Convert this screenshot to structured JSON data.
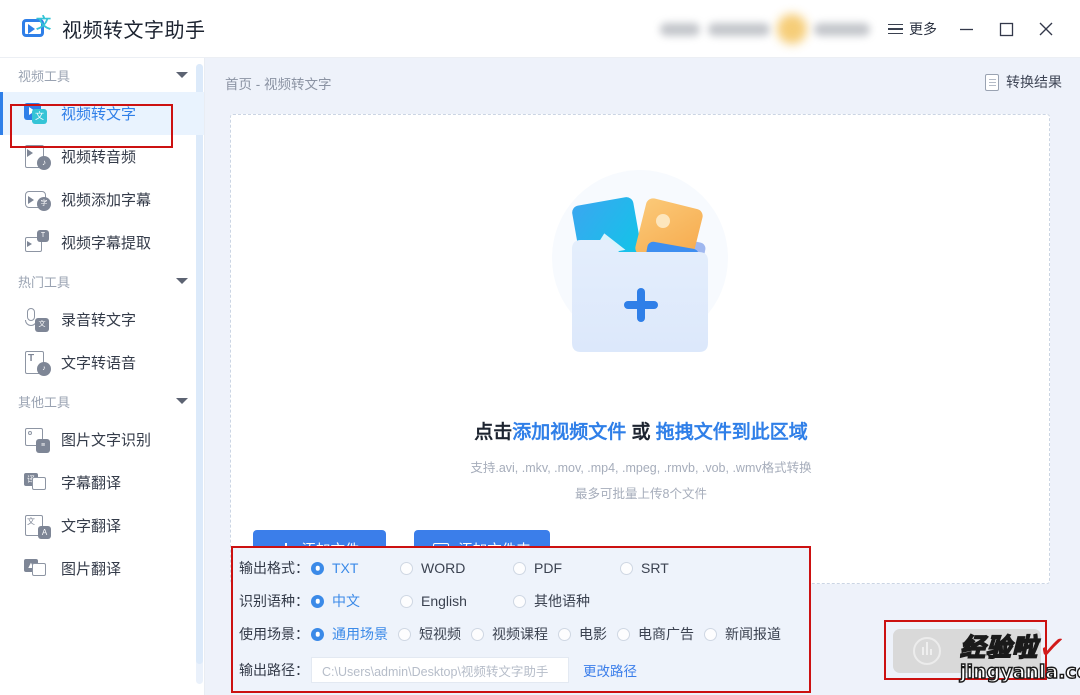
{
  "titlebar": {
    "app_name": "视频转文字助手",
    "logo_icon": "video-to-text-logo-icon",
    "more_label": "更多",
    "more_icon": "hamburger-icon",
    "minimize_icon": "minimize-icon",
    "maximize_icon": "maximize-icon",
    "close_icon": "close-icon",
    "account_blurred": true
  },
  "sidebar": {
    "groups": [
      {
        "label": "视频工具",
        "caret_icon": "chevron-down-icon",
        "items": [
          {
            "label": "视频转文字",
            "icon": "video-to-text-icon",
            "active": true
          },
          {
            "label": "视频转音频",
            "icon": "video-to-audio-icon",
            "active": false
          },
          {
            "label": "视频添加字幕",
            "icon": "video-add-subtitle-icon",
            "active": false
          },
          {
            "label": "视频字幕提取",
            "icon": "video-extract-subtitle-icon",
            "active": false
          }
        ]
      },
      {
        "label": "热门工具",
        "caret_icon": "chevron-down-icon",
        "items": [
          {
            "label": "录音转文字",
            "icon": "audio-to-text-icon",
            "active": false
          },
          {
            "label": "文字转语音",
            "icon": "text-to-speech-icon",
            "active": false
          }
        ]
      },
      {
        "label": "其他工具",
        "caret_icon": "chevron-down-icon",
        "items": [
          {
            "label": "图片文字识别",
            "icon": "image-ocr-icon",
            "active": false
          },
          {
            "label": "字幕翻译",
            "icon": "subtitle-translate-icon",
            "active": false
          },
          {
            "label": "文字翻译",
            "icon": "text-translate-icon",
            "active": false
          },
          {
            "label": "图片翻译",
            "icon": "image-translate-icon",
            "active": false
          }
        ]
      }
    ]
  },
  "content": {
    "breadcrumb": "首页 - 视频转文字",
    "result_link": "转换结果",
    "result_icon": "document-icon",
    "dropzone": {
      "illustration_icon": "folder-with-media-plus-icon",
      "headline_prefix": "点击",
      "headline_link1": "添加视频文件",
      "headline_middle": " 或 ",
      "headline_link2": "拖拽文件到此区域",
      "formats": "支持.avi, .mkv, .mov, .mp4, .mpeg, .rmvb, .vob, .wmv格式转换",
      "limit": "最多可批量上传8个文件",
      "add_file_button": "添加文件",
      "add_file_icon": "plus-icon",
      "add_folder_button": "添加文件夹",
      "add_folder_icon": "folder-icon"
    }
  },
  "options": {
    "rows": [
      {
        "label": "输出格式：",
        "choices": [
          {
            "text": "TXT",
            "selected": true
          },
          {
            "text": "WORD",
            "selected": false
          },
          {
            "text": "PDF",
            "selected": false
          },
          {
            "text": "SRT",
            "selected": false
          }
        ]
      },
      {
        "label": "识别语种：",
        "choices": [
          {
            "text": "中文",
            "selected": true
          },
          {
            "text": "English",
            "selected": false
          },
          {
            "text": "其他语种",
            "selected": false
          }
        ]
      },
      {
        "label": "使用场景：",
        "choices": [
          {
            "text": "通用场景",
            "selected": true
          },
          {
            "text": "短视频",
            "selected": false
          },
          {
            "text": "视频课程",
            "selected": false
          },
          {
            "text": "电影",
            "selected": false
          },
          {
            "text": "电商广告",
            "selected": false
          },
          {
            "text": "新闻报道",
            "selected": false
          }
        ]
      }
    ],
    "path_label": "输出路径：",
    "path_value": "C:\\Users\\admin\\Desktop\\视频转文字助手",
    "path_change_label": "更改路径"
  },
  "convert": {
    "icon": "audio-wave-circle-icon"
  },
  "watermark": {
    "cn": "经验啦",
    "en": "jingyanla.com",
    "check_icon": "red-check-icon"
  },
  "colors": {
    "accent": "#2f7fe8",
    "button_blue": "#3b7eea",
    "panel_bg": "#eef3fb",
    "annotation_red": "#cc1111",
    "page_bg": "#eef2fa"
  }
}
